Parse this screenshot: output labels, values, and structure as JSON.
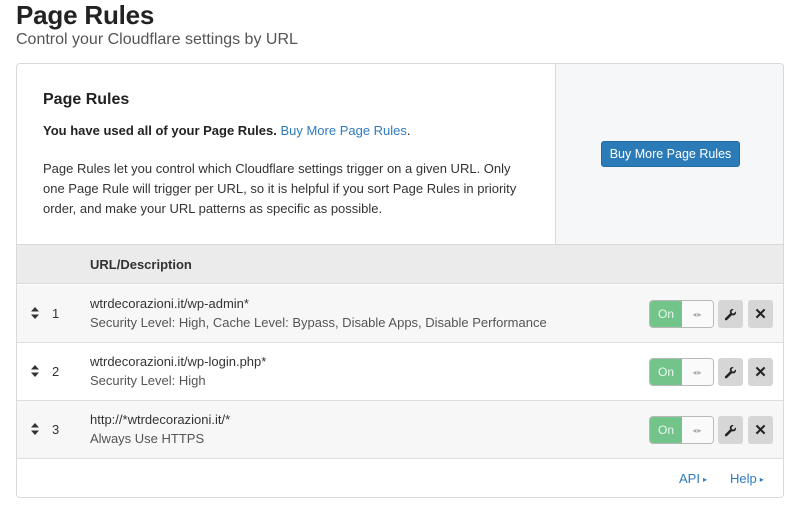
{
  "header": {
    "title": "Page Rules",
    "subtitle": "Control your Cloudflare settings by URL"
  },
  "info": {
    "title": "Page Rules",
    "used_bold": "You have used all of your Page Rules.",
    "buy_link": "Buy More Page Rules",
    "buy_link_suffix": ".",
    "description": "Page Rules let you control which Cloudflare settings trigger on a given URL. Only one Page Rule will trigger per URL, so it is helpful if you sort Page Rules in priority order, and make your URL patterns as specific as possible.",
    "buy_button": "Buy More Page Rules"
  },
  "table": {
    "column_header": "URL/Description",
    "rows": [
      {
        "priority": "1",
        "url": "wtrdecorazioni.it/wp-admin*",
        "description": "Security Level: High, Cache Level: Bypass, Disable Apps, Disable Performance",
        "status": "On"
      },
      {
        "priority": "2",
        "url": "wtrdecorazioni.it/wp-login.php*",
        "description": "Security Level: High",
        "status": "On"
      },
      {
        "priority": "3",
        "url": "http://*wtrdecorazioni.it/*",
        "description": "Always Use HTTPS",
        "status": "On"
      }
    ],
    "toggle_handle_glyph": "◂▸",
    "delete_glyph": "✕"
  },
  "footer": {
    "api_link": "API",
    "help_link": "Help",
    "caret": "▸"
  },
  "colors": {
    "accent": "#2b7bb9",
    "link": "#2f7bbf",
    "toggle_on": "#72c48a"
  }
}
